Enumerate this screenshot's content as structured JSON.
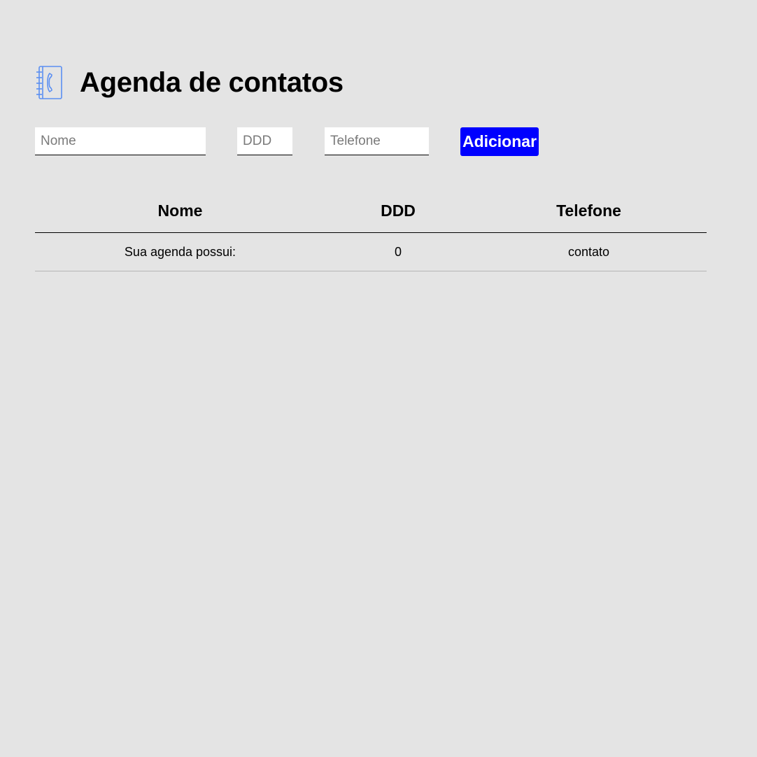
{
  "header": {
    "icon": "phone-book-icon",
    "title": "Agenda de contatos"
  },
  "form": {
    "nome_placeholder": "Nome",
    "ddd_placeholder": "DDD",
    "telefone_placeholder": "Telefone",
    "nome_value": "",
    "ddd_value": "",
    "telefone_value": "",
    "add_button_label": "Adicionar",
    "button_color": "#0000ff"
  },
  "table": {
    "headers": [
      "Nome",
      "DDD",
      "Telefone"
    ],
    "footer_row": [
      "Sua agenda possui:",
      "0",
      "contato"
    ]
  }
}
